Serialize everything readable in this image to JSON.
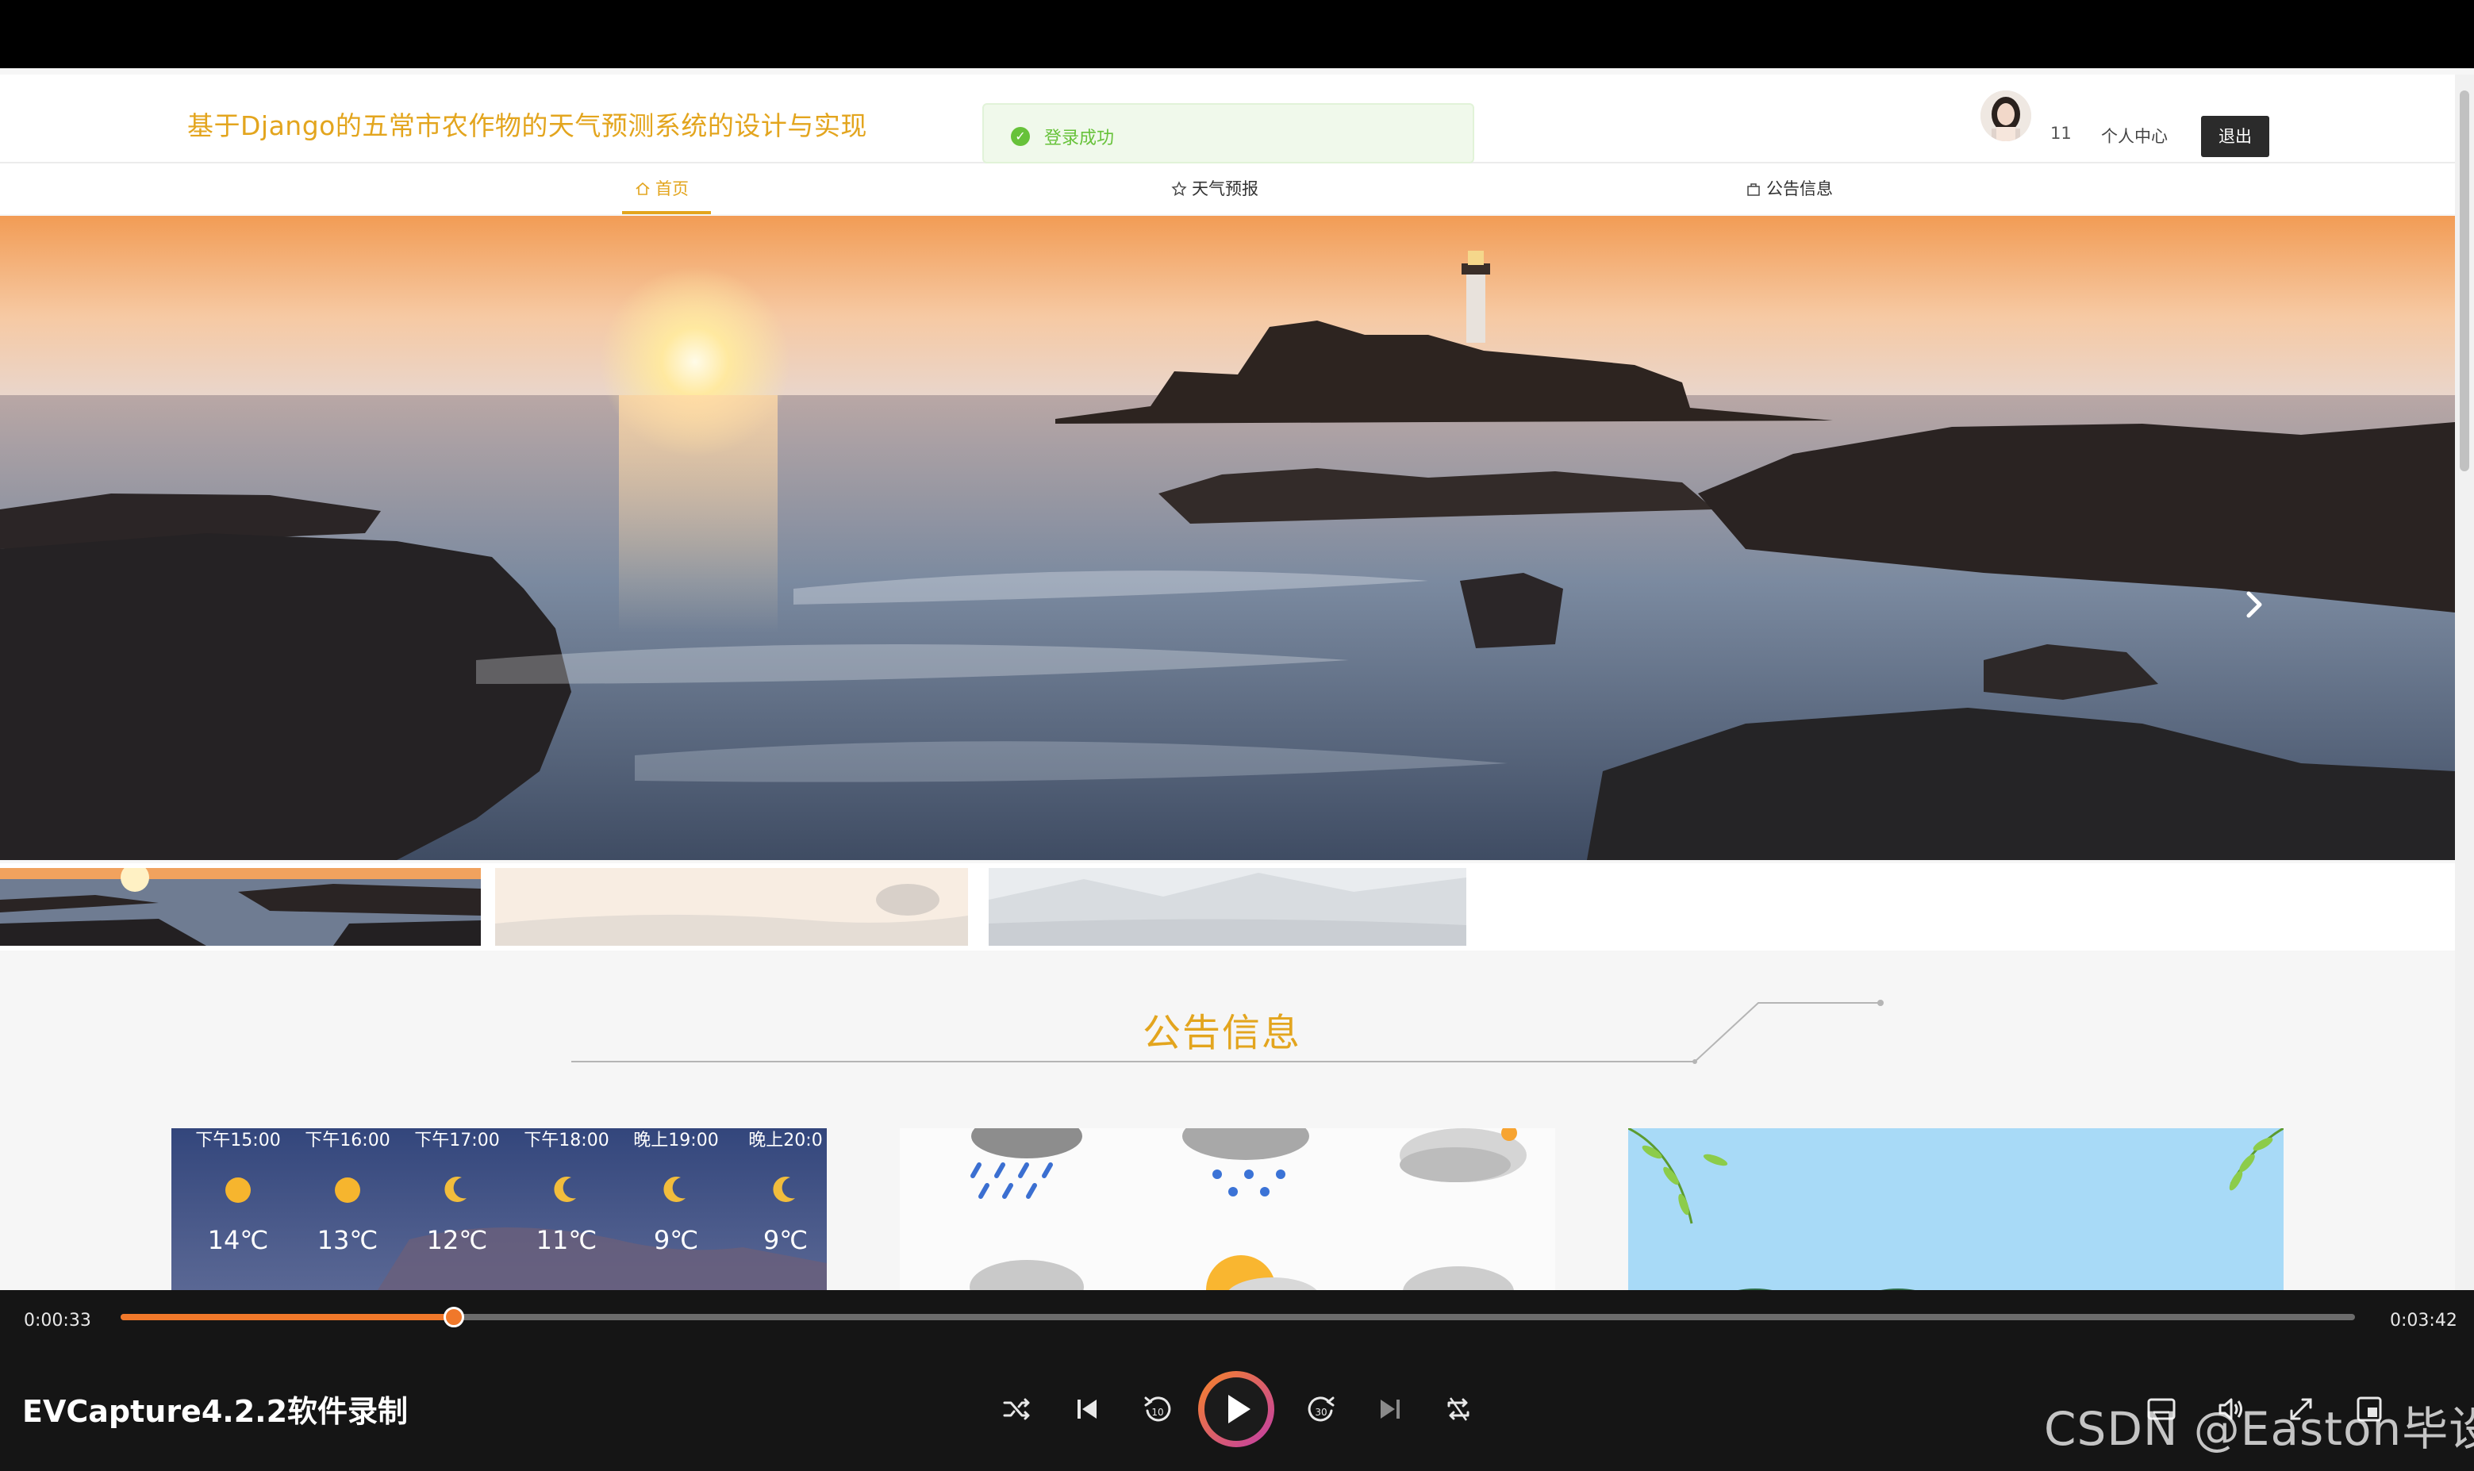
{
  "site": {
    "title": "基于Django的五常市农作物的天气预测系统的设计与实现",
    "brand_color": "#e3a51e"
  },
  "toast": {
    "message": "登录成功",
    "icon": "check-circle-icon",
    "color": "#67c23a"
  },
  "user": {
    "name": "11",
    "profile_label": "个人中心",
    "logout_label": "退出"
  },
  "nav": {
    "items": [
      {
        "label": "首页",
        "icon": "home-icon",
        "active": true
      },
      {
        "label": "天气预报",
        "icon": "star-icon",
        "active": false
      },
      {
        "label": "公告信息",
        "icon": "bag-icon",
        "active": false
      }
    ]
  },
  "carousel": {
    "next_icon": "chevron-right-icon",
    "active_index": 0,
    "thumbnail_count": 3
  },
  "section": {
    "title": "公告信息"
  },
  "weather_card": {
    "times": [
      "下午15:00",
      "下午16:00",
      "下午17:00",
      "下午18:00",
      "晚上19:00",
      "晚上20:0"
    ],
    "temps": [
      "14℃",
      "13℃",
      "12℃",
      "11℃",
      "9℃",
      "9℃"
    ]
  },
  "player": {
    "current_time": "0:00:33",
    "total_time": "0:03:42",
    "progress_fraction": 0.149,
    "accent_color": "#f0782a",
    "brand_label": "EVCapture4.2.2软件录制",
    "controls": [
      "shuffle-icon",
      "previous-icon",
      "rewind-10-icon",
      "play-icon",
      "forward-30-icon",
      "next-icon",
      "repeat-icon"
    ],
    "right_controls": [
      "subtitle-icon",
      "volume-icon",
      "fullscreen-icon",
      "pip-icon"
    ]
  },
  "watermark": "CSDN @Easton毕设"
}
